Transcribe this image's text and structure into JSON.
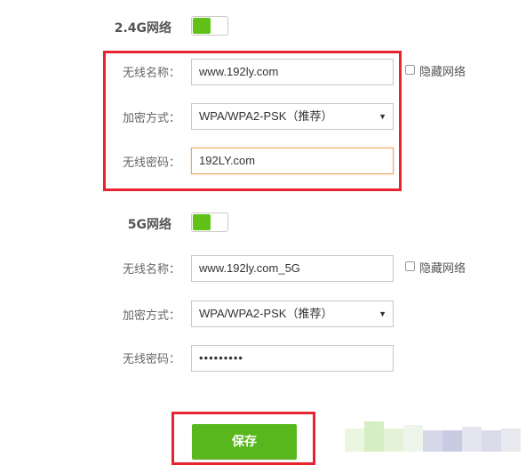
{
  "colors": {
    "accent_green": "#62c116",
    "button_green": "#58b71c",
    "highlight_red": "#e8242f",
    "focus_border": "#f0a45e"
  },
  "sections": [
    {
      "title": "2.4G网络",
      "enabled": true,
      "ssid_label": "无线名称：",
      "ssid_value": "www.192ly.com",
      "hide_label": "隐藏网络",
      "hide_checked": false,
      "encryption_label": "加密方式：",
      "encryption_value": "WPA/WPA2-PSK（推荐）",
      "password_label": "无线密码：",
      "password_value": "192LY.com"
    },
    {
      "title": "5G网络",
      "enabled": true,
      "ssid_label": "无线名称：",
      "ssid_value": "www.192ly.com_5G",
      "hide_label": "隐藏网络",
      "hide_checked": false,
      "encryption_label": "加密方式：",
      "encryption_value": "WPA/WPA2-PSK（推荐）",
      "password_label": "无线密码：",
      "password_value": "•••••••••"
    }
  ],
  "save_label": "保存",
  "icons": {
    "dropdown": "triangle-down-icon"
  }
}
